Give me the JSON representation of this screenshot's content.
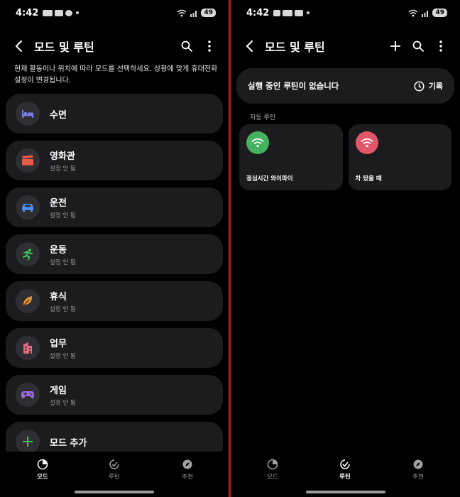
{
  "status_bar": {
    "time": "4:42",
    "battery": "49"
  },
  "left": {
    "title": "모드 및 루틴",
    "description": "현재 활동이나 위치에 따라 모드를 선택하세요. 상황에 맞게 휴대전화 설정이 변경됩니다.",
    "modes": [
      {
        "name": "수면",
        "sub": "",
        "icon": "sleep-bed-icon",
        "color": "#7b7fe6"
      },
      {
        "name": "영화관",
        "sub": "설정 안 됨",
        "icon": "movie-clapper-icon",
        "color": "#e55a48"
      },
      {
        "name": "운전",
        "sub": "설정 안 됨",
        "icon": "car-icon",
        "color": "#4d8ee8"
      },
      {
        "name": "운동",
        "sub": "설정 안 됨",
        "icon": "running-icon",
        "color": "#3fbf5a"
      },
      {
        "name": "휴식",
        "sub": "설정 안 됨",
        "icon": "leaf-icon",
        "color": "#e4902e"
      },
      {
        "name": "업무",
        "sub": "설정 안 됨",
        "icon": "building-icon",
        "color": "#e06a80"
      },
      {
        "name": "게임",
        "sub": "설정 안 됨",
        "icon": "gamepad-icon",
        "color": "#9b6be0"
      },
      {
        "name": "모드 추가",
        "sub": "",
        "icon": "plus-icon",
        "color": "#3fbf5a"
      }
    ],
    "nav": [
      {
        "label": "모드",
        "icon": "modes-icon",
        "active": true
      },
      {
        "label": "루틴",
        "icon": "routine-check-icon",
        "active": false
      },
      {
        "label": "추천",
        "icon": "compass-icon",
        "active": false
      }
    ]
  },
  "right": {
    "title": "모드 및 루틴",
    "status_text": "실행 중인 루틴이 없습니다",
    "history_label": "기록",
    "section_label": "자동 루틴",
    "routines": [
      {
        "name": "점심시간 와이파이",
        "icon": "wifi-icon",
        "color": "#43b360"
      },
      {
        "name": "차 탔을 때",
        "icon": "wifi-icon",
        "color": "#e2566a"
      }
    ],
    "nav": [
      {
        "label": "모드",
        "icon": "modes-icon",
        "active": false
      },
      {
        "label": "루틴",
        "icon": "routine-check-icon",
        "active": true
      },
      {
        "label": "추천",
        "icon": "compass-icon",
        "active": false
      }
    ]
  }
}
